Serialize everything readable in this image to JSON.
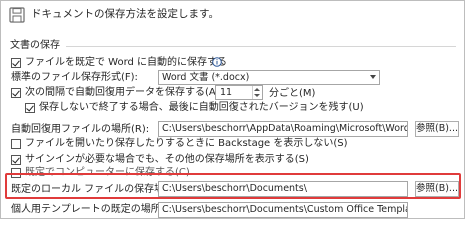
{
  "header": {
    "icon": "save-settings-icon",
    "title": "ドキュメントの保存方法を設定します。"
  },
  "section": {
    "title": "文書の保存"
  },
  "options": {
    "save_format_checkbox_label": "ファイルを既定で Word に自動的に保存する",
    "info_icon": "info-icon",
    "default_format_label": "標準のファイル保存形式(F):",
    "default_format_value": "Word 文書 (*.docx)",
    "autorecover_label": "次の間隔で自動回復用データを保存する(A):",
    "autorecover_minutes": "11",
    "autorecover_unit": "分ごと(M)",
    "keep_last_version_label": "保存しないで終了する場合、最後に自動回復されたバージョンを残す(U)",
    "autorecover_location_label": "自動回復用ファイルの場所(R):",
    "autorecover_location_value": "C:\\Users\\beschorr\\AppData\\Roaming\\Microsoft\\Word\\",
    "browse_label": "参照(B)...",
    "backstage_label": "ファイルを開いたり保存したりするときに Backstage を表示しない(S)",
    "additional_places_label": "サインインが必要な場合でも、その他の保存場所を表示する(S)",
    "save_to_computer_label": "既定でコンピューターに保存する(C)",
    "local_file_location_label": "既定のローカル ファイルの保存場所(I):",
    "local_file_location_value": "C:\\Users\\beschorr\\Documents\\",
    "browse2_label": "参照(B)...",
    "template_location_label": "個人用テンプレートの既定の場所(T):",
    "template_location_value": "C:\\Users\\beschorr\\Documents\\Custom Office Templates\\",
    "checked": {
      "save_format": true,
      "autorecover": true,
      "keep_last_version": true,
      "backstage": false,
      "additional_places": true,
      "save_to_computer": false
    }
  },
  "colors": {
    "highlight": "#e03b3b",
    "accent": "#2b579a"
  }
}
